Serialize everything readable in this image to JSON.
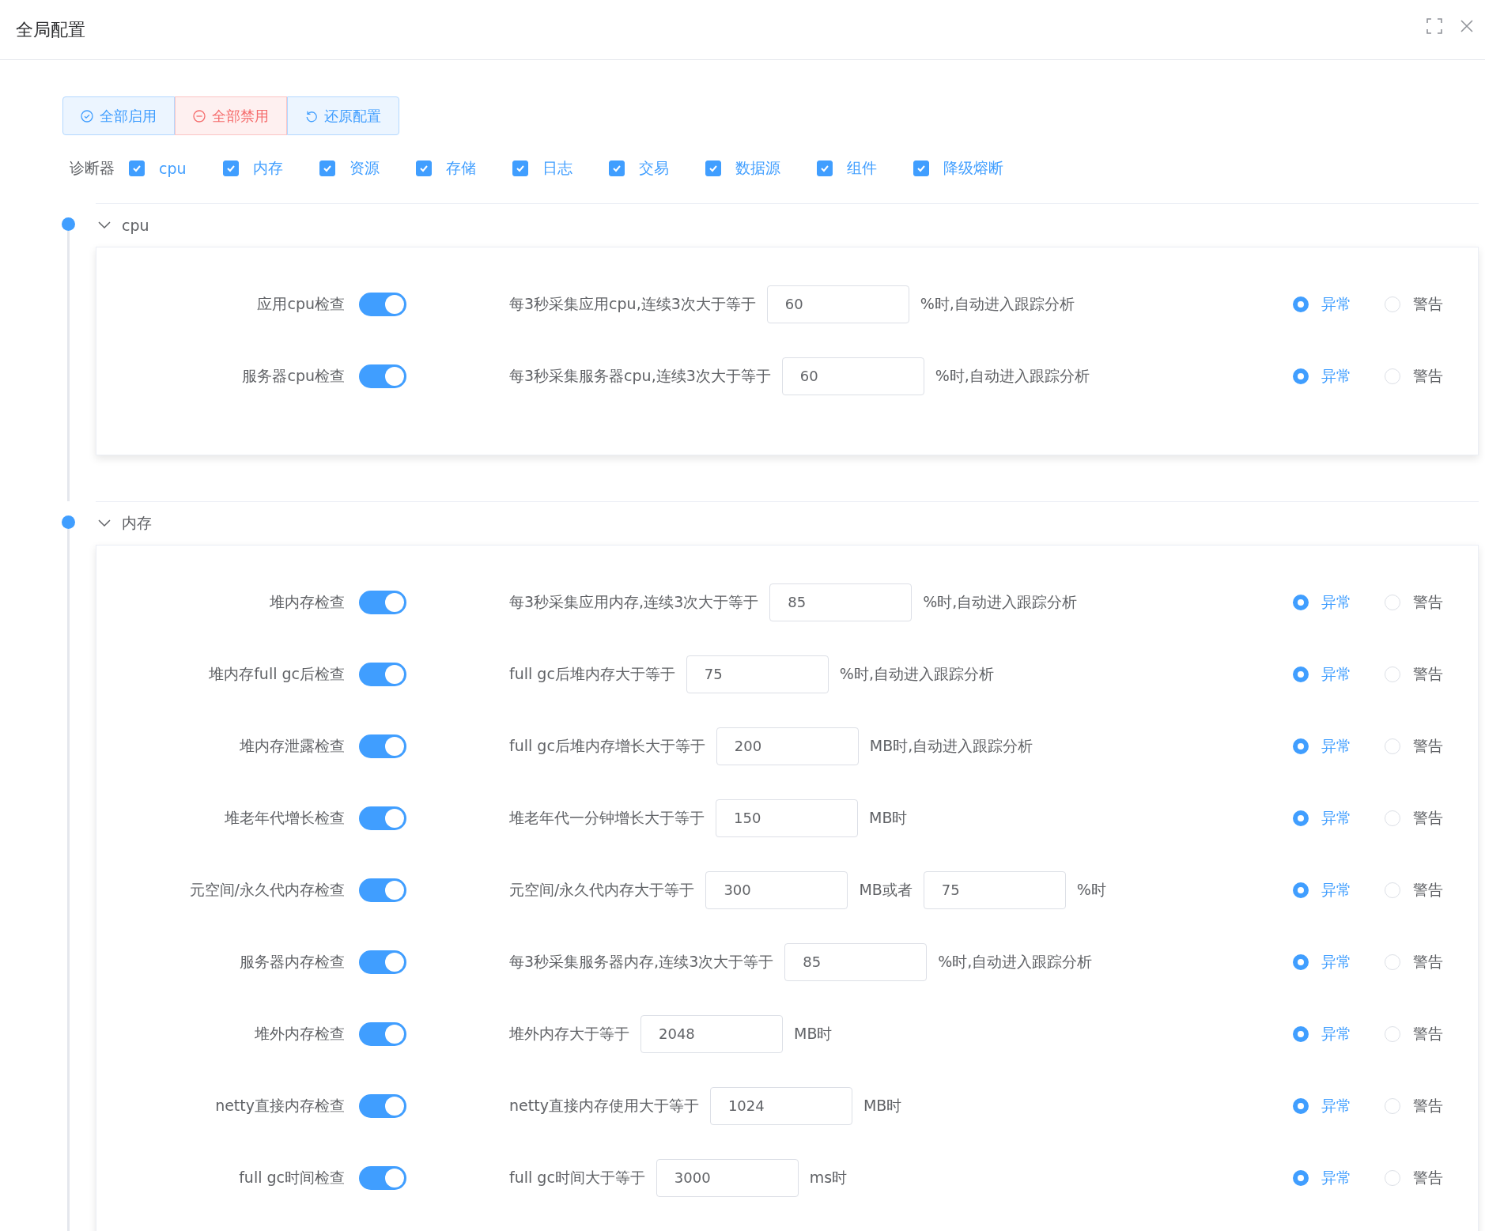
{
  "window": {
    "title": "全局配置"
  },
  "actions": [
    {
      "kind": "enable",
      "label": "全部启用"
    },
    {
      "kind": "disable",
      "label": "全部禁用"
    },
    {
      "kind": "reset",
      "label": "还原配置"
    }
  ],
  "diagnostics": {
    "label": "诊断器",
    "items": [
      {
        "label": "cpu",
        "checked": true
      },
      {
        "label": "内存",
        "checked": true
      },
      {
        "label": "资源",
        "checked": true
      },
      {
        "label": "存储",
        "checked": true
      },
      {
        "label": "日志",
        "checked": true
      },
      {
        "label": "交易",
        "checked": true
      },
      {
        "label": "数据源",
        "checked": true
      },
      {
        "label": "组件",
        "checked": true
      },
      {
        "label": "降级熔断",
        "checked": true
      }
    ]
  },
  "sections": [
    {
      "title": "cpu",
      "expanded": true,
      "checks": [
        {
          "label": "应用cpu检查",
          "on": true,
          "parts": [
            {
              "kind": "text",
              "text": "每3秒采集应用cpu,连续3次大于等于"
            },
            {
              "kind": "input",
              "value": "60"
            },
            {
              "kind": "text",
              "text": "%时,自动进入跟踪分析"
            }
          ],
          "options": [
            {
              "label": "异常",
              "selected": true
            },
            {
              "label": "警告",
              "selected": false
            }
          ]
        },
        {
          "label": "服务器cpu检查",
          "on": true,
          "parts": [
            {
              "kind": "text",
              "text": "每3秒采集服务器cpu,连续3次大于等于"
            },
            {
              "kind": "input",
              "value": "60"
            },
            {
              "kind": "text",
              "text": "%时,自动进入跟踪分析"
            }
          ],
          "options": [
            {
              "label": "异常",
              "selected": true
            },
            {
              "label": "警告",
              "selected": false
            }
          ]
        }
      ]
    },
    {
      "title": "内存",
      "expanded": true,
      "checks": [
        {
          "label": "堆内存检查",
          "on": true,
          "parts": [
            {
              "kind": "text",
              "text": "每3秒采集应用内存,连续3次大于等于"
            },
            {
              "kind": "input",
              "value": "85"
            },
            {
              "kind": "text",
              "text": "%时,自动进入跟踪分析"
            }
          ],
          "options": [
            {
              "label": "异常",
              "selected": true
            },
            {
              "label": "警告",
              "selected": false
            }
          ]
        },
        {
          "label": "堆内存full gc后检查",
          "on": true,
          "parts": [
            {
              "kind": "text",
              "text": "full gc后堆内存大于等于"
            },
            {
              "kind": "input",
              "value": "75"
            },
            {
              "kind": "text",
              "text": "%时,自动进入跟踪分析"
            }
          ],
          "options": [
            {
              "label": "异常",
              "selected": true
            },
            {
              "label": "警告",
              "selected": false
            }
          ]
        },
        {
          "label": "堆内存泄露检查",
          "on": true,
          "parts": [
            {
              "kind": "text",
              "text": "full gc后堆内存增长大于等于"
            },
            {
              "kind": "input",
              "value": "200"
            },
            {
              "kind": "text",
              "text": "MB时,自动进入跟踪分析"
            }
          ],
          "options": [
            {
              "label": "异常",
              "selected": true
            },
            {
              "label": "警告",
              "selected": false
            }
          ]
        },
        {
          "label": "堆老年代增长检查",
          "on": true,
          "parts": [
            {
              "kind": "text",
              "text": "堆老年代一分钟增长大于等于"
            },
            {
              "kind": "input",
              "value": "150"
            },
            {
              "kind": "text",
              "text": "MB时"
            }
          ],
          "options": [
            {
              "label": "异常",
              "selected": true
            },
            {
              "label": "警告",
              "selected": false
            }
          ]
        },
        {
          "label": "元空间/永久代内存检查",
          "on": true,
          "parts": [
            {
              "kind": "text",
              "text": "元空间/永久代内存大于等于"
            },
            {
              "kind": "input",
              "value": "300"
            },
            {
              "kind": "text",
              "text": "MB或者"
            },
            {
              "kind": "input",
              "value": "75"
            },
            {
              "kind": "text",
              "text": "%时"
            }
          ],
          "options": [
            {
              "label": "异常",
              "selected": true
            },
            {
              "label": "警告",
              "selected": false
            }
          ]
        },
        {
          "label": "服务器内存检查",
          "on": true,
          "parts": [
            {
              "kind": "text",
              "text": "每3秒采集服务器内存,连续3次大于等于"
            },
            {
              "kind": "input",
              "value": "85"
            },
            {
              "kind": "text",
              "text": "%时,自动进入跟踪分析"
            }
          ],
          "options": [
            {
              "label": "异常",
              "selected": true
            },
            {
              "label": "警告",
              "selected": false
            }
          ]
        },
        {
          "label": "堆外内存检查",
          "on": true,
          "parts": [
            {
              "kind": "text",
              "text": "堆外内存大于等于"
            },
            {
              "kind": "input",
              "value": "2048"
            },
            {
              "kind": "text",
              "text": "MB时"
            }
          ],
          "options": [
            {
              "label": "异常",
              "selected": true
            },
            {
              "label": "警告",
              "selected": false
            }
          ]
        },
        {
          "label": "netty直接内存检查",
          "on": true,
          "parts": [
            {
              "kind": "text",
              "text": "netty直接内存使用大于等于"
            },
            {
              "kind": "input",
              "value": "1024"
            },
            {
              "kind": "text",
              "text": "MB时"
            }
          ],
          "options": [
            {
              "label": "异常",
              "selected": true
            },
            {
              "label": "警告",
              "selected": false
            }
          ]
        },
        {
          "label": "full gc时间检查",
          "on": true,
          "parts": [
            {
              "kind": "text",
              "text": "full gc时间大于等于"
            },
            {
              "kind": "input",
              "value": "3000"
            },
            {
              "kind": "text",
              "text": "ms时"
            }
          ],
          "options": [
            {
              "label": "异常",
              "selected": true
            },
            {
              "label": "警告",
              "selected": false
            }
          ]
        }
      ]
    }
  ]
}
